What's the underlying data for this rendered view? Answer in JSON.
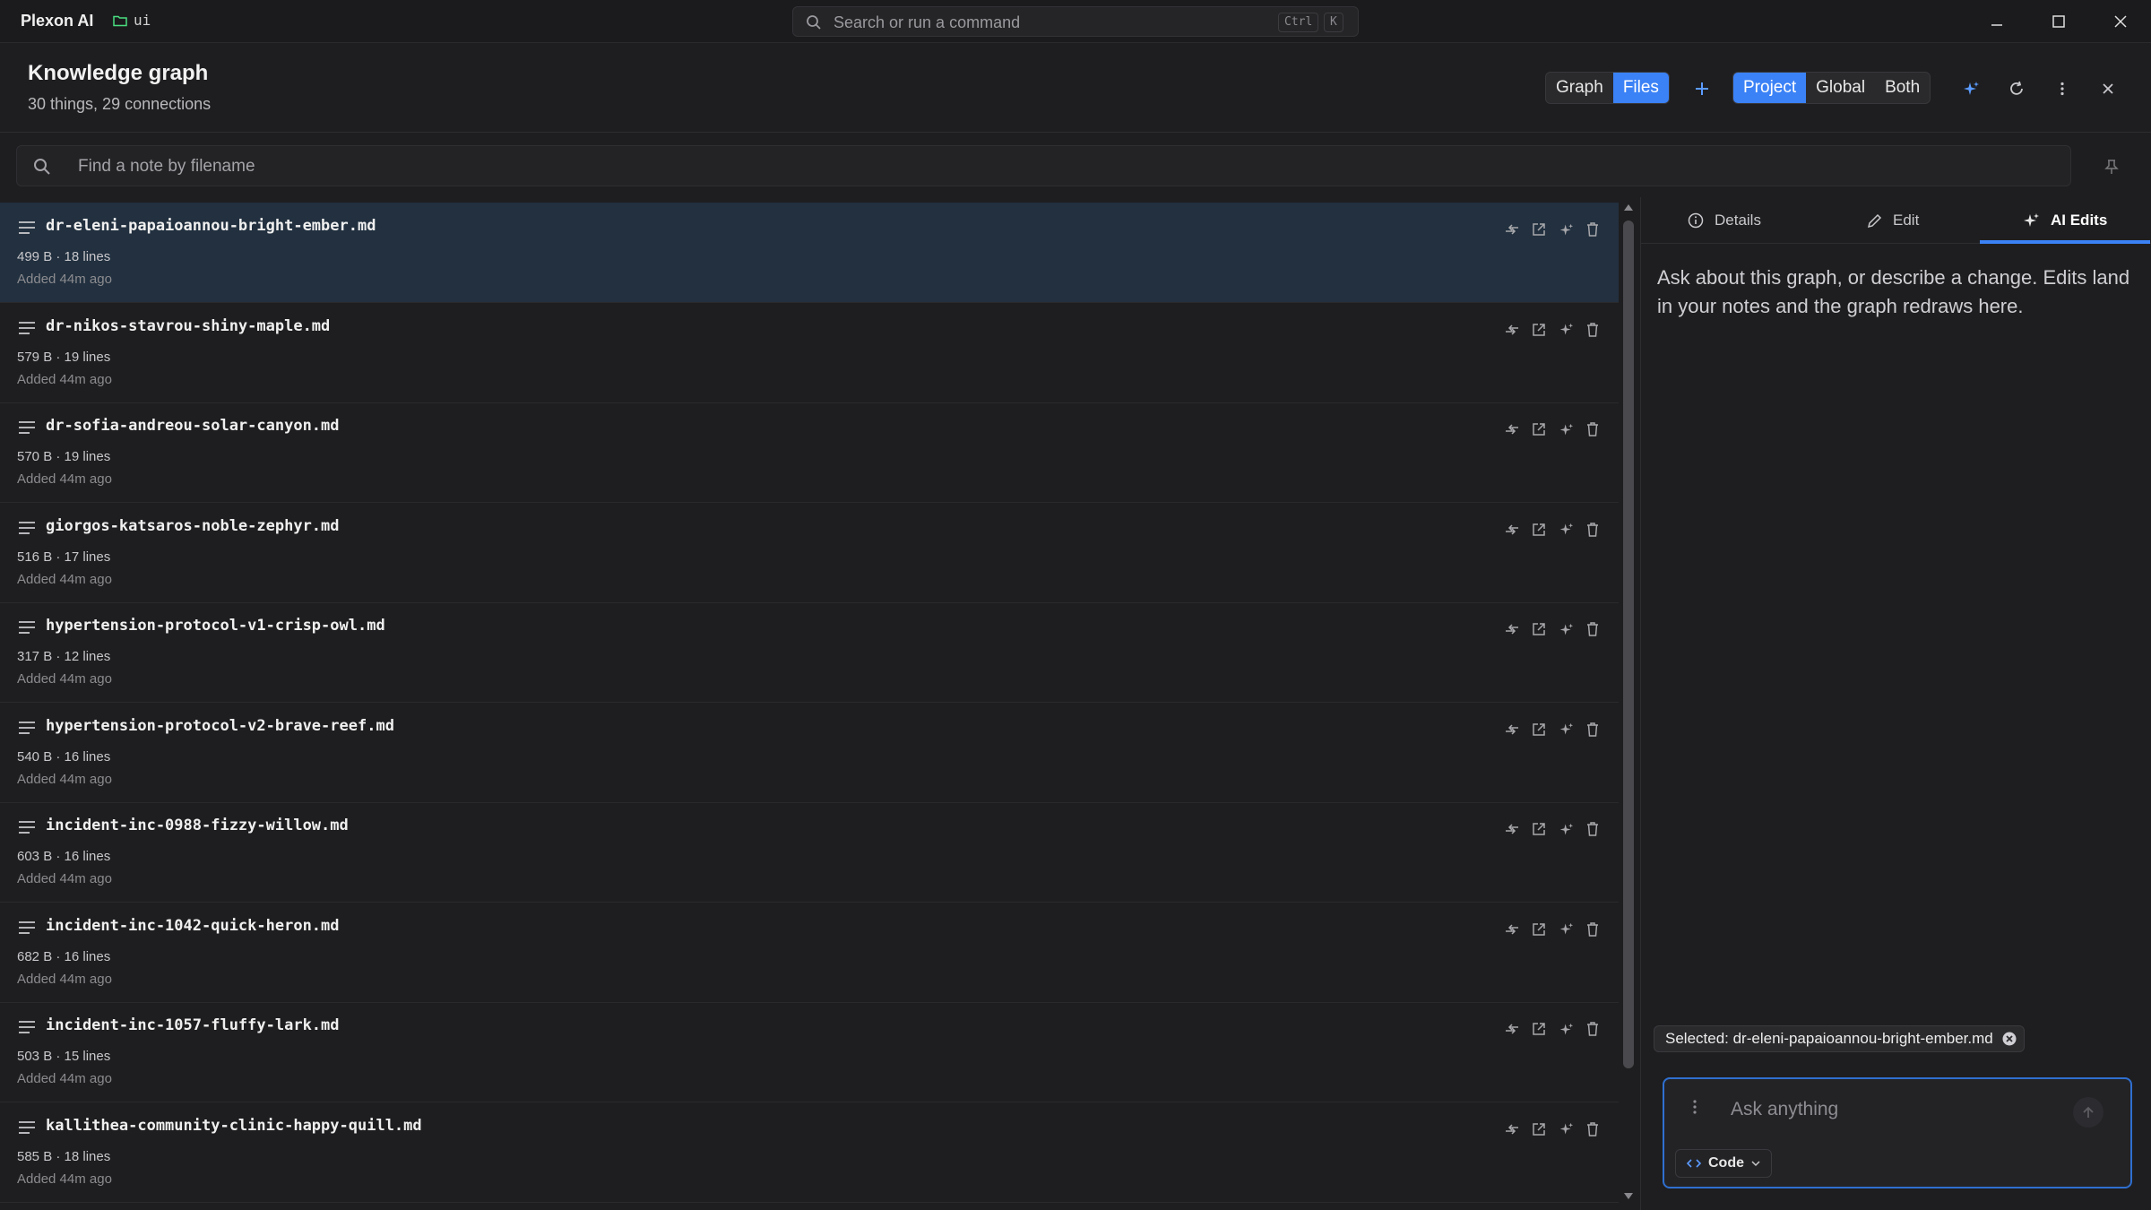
{
  "app": {
    "name": "Plexon AI",
    "folder": "ui"
  },
  "command_search": {
    "placeholder": "Search or run a command",
    "key1": "Ctrl",
    "key2": "K"
  },
  "header": {
    "title": "Knowledge graph",
    "subtitle": "30 things, 29 connections",
    "view_toggle": [
      {
        "label": "Graph",
        "active": false
      },
      {
        "label": "Files",
        "active": true
      }
    ],
    "scope_toggle": [
      {
        "label": "Project",
        "active": true
      },
      {
        "label": "Global",
        "active": false
      },
      {
        "label": "Both",
        "active": false
      }
    ]
  },
  "filter": {
    "placeholder": "Find a note by filename"
  },
  "files": [
    {
      "name": "dr-eleni-papaioannou-bright-ember.md",
      "meta": "499 B · 18 lines",
      "added": "Added 44m ago",
      "selected": true
    },
    {
      "name": "dr-nikos-stavrou-shiny-maple.md",
      "meta": "579 B · 19 lines",
      "added": "Added 44m ago",
      "selected": false
    },
    {
      "name": "dr-sofia-andreou-solar-canyon.md",
      "meta": "570 B · 19 lines",
      "added": "Added 44m ago",
      "selected": false
    },
    {
      "name": "giorgos-katsaros-noble-zephyr.md",
      "meta": "516 B · 17 lines",
      "added": "Added 44m ago",
      "selected": false
    },
    {
      "name": "hypertension-protocol-v1-crisp-owl.md",
      "meta": "317 B · 12 lines",
      "added": "Added 44m ago",
      "selected": false
    },
    {
      "name": "hypertension-protocol-v2-brave-reef.md",
      "meta": "540 B · 16 lines",
      "added": "Added 44m ago",
      "selected": false
    },
    {
      "name": "incident-inc-0988-fizzy-willow.md",
      "meta": "603 B · 16 lines",
      "added": "Added 44m ago",
      "selected": false
    },
    {
      "name": "incident-inc-1042-quick-heron.md",
      "meta": "682 B · 16 lines",
      "added": "Added 44m ago",
      "selected": false
    },
    {
      "name": "incident-inc-1057-fluffy-lark.md",
      "meta": "503 B · 15 lines",
      "added": "Added 44m ago",
      "selected": false
    },
    {
      "name": "kallithea-community-clinic-happy-quill.md",
      "meta": "585 B · 18 lines",
      "added": "Added 44m ago",
      "selected": false
    }
  ],
  "panel": {
    "tabs": [
      {
        "label": "Details",
        "icon": "info-icon",
        "active": false
      },
      {
        "label": "Edit",
        "icon": "pencil-icon",
        "active": false
      },
      {
        "label": "AI Edits",
        "icon": "sparkle-icon",
        "active": true
      }
    ],
    "hint": "Ask about this graph, or describe a change. Edits land in your notes and the graph redraws here.",
    "selected_chip": "Selected: dr-eleni-papaioannou-bright-ember.md",
    "composer": {
      "placeholder": "Ask anything",
      "mode_label": "Code"
    }
  },
  "colors": {
    "accent": "#3b82f6",
    "selected_row": "#22303f",
    "background": "#1e1e20"
  }
}
